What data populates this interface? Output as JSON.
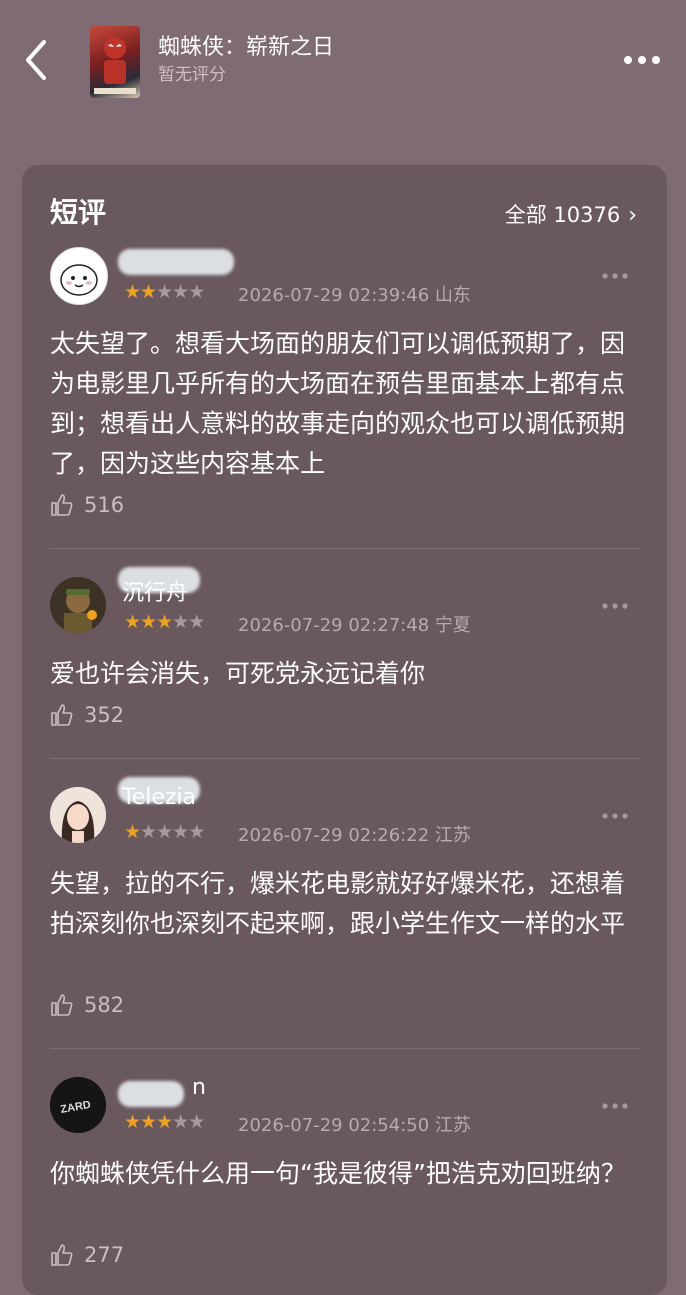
{
  "header": {
    "title": "蜘蛛侠：崭新之日",
    "rating_text": "暂无评分"
  },
  "section": {
    "title": "短评",
    "all_label": "全部 10376",
    "chevron": "›"
  },
  "reviews": [
    {
      "username": "",
      "stars": 2,
      "timestamp": "2026-07-29 02:39:46",
      "location": "山东",
      "text": "太失望了。想看大场面的朋友们可以调低预期了，因为电影里几乎所有的大场面在预告里面基本上都有点到；想看出人意料的故事走向的观众也可以调低预期了，因为这些内容基本上",
      "likes": "516"
    },
    {
      "username": "沉行舟",
      "stars": 3,
      "timestamp": "2026-07-29 02:27:48",
      "location": "宁夏",
      "text": "爱也许会消失，可死党永远记着你",
      "likes": "352"
    },
    {
      "username": "Telezia",
      "stars": 1,
      "timestamp": "2026-07-29 02:26:22",
      "location": "江苏",
      "text": "失望，拉的不行，爆米花电影就好好爆米花，还想着拍深刻你也深刻不起来啊，跟小学生作文一样的水平",
      "likes": "582"
    },
    {
      "username": "n",
      "stars": 3,
      "timestamp": "2026-07-29 02:54:50",
      "location": "江苏",
      "text": "你蜘蛛侠凭什么用一句“我是彼得”把浩克劝回班纳？",
      "likes": "277"
    }
  ],
  "colors": {
    "background": "#7f6b74",
    "panel": "#6a585f",
    "star_on": "#f0a11c",
    "star_off": "#a8999f"
  }
}
